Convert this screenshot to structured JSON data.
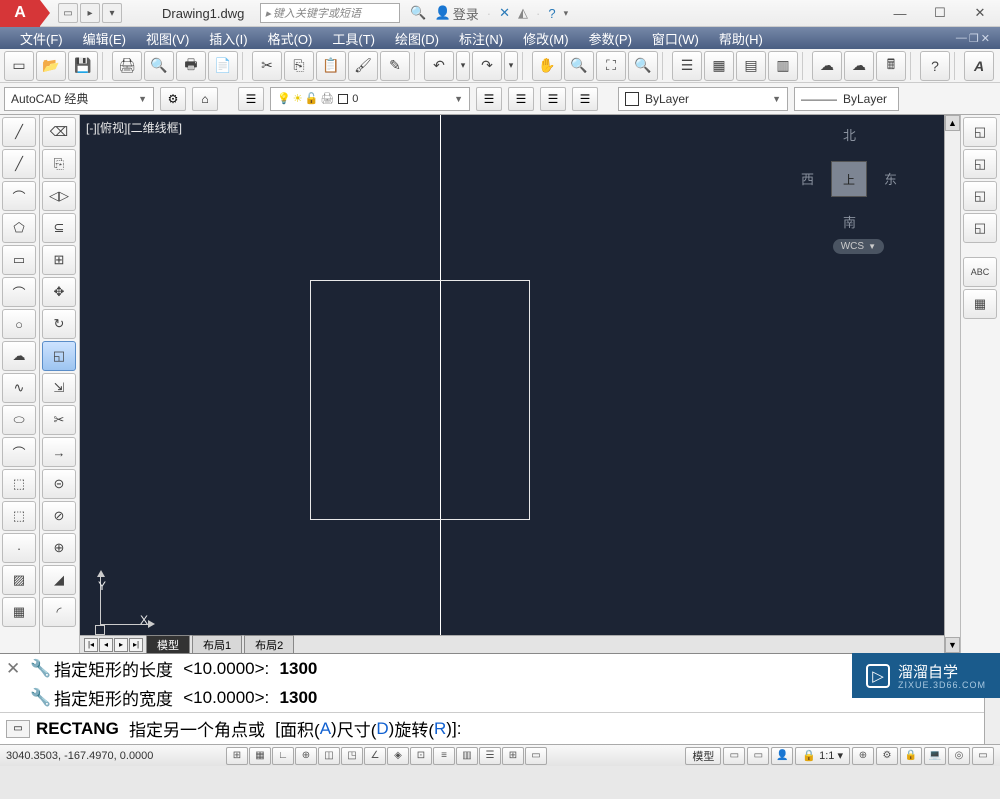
{
  "title": {
    "filename": "Drawing1.dwg",
    "search_placeholder": "键入关键字或短语",
    "login": "登录"
  },
  "menu": {
    "items": [
      "文件(F)",
      "编辑(E)",
      "视图(V)",
      "插入(I)",
      "格式(O)",
      "工具(T)",
      "绘图(D)",
      "标注(N)",
      "修改(M)",
      "参数(P)",
      "窗口(W)",
      "帮助(H)"
    ]
  },
  "workspace": {
    "label": "AutoCAD 经典"
  },
  "layer": {
    "combo": "0",
    "bylayer1": "ByLayer",
    "bylayer2": "ByLayer"
  },
  "canvas": {
    "label": "[-][俯视][二维线框]"
  },
  "viewcube": {
    "face": "上",
    "n": "北",
    "s": "南",
    "e": "东",
    "w": "西",
    "wcs": "WCS"
  },
  "tabs": {
    "model": "模型",
    "layout1": "布局1",
    "layout2": "布局2"
  },
  "cmd": {
    "hist1_label": "指定矩形的长度",
    "hist1_default": "<10.0000>:",
    "hist1_val": "1300",
    "hist2_label": "指定矩形的宽度",
    "hist2_default": "<10.0000>:",
    "hist2_val": "1300",
    "cmd_name": "RECTANG",
    "cmd_prompt": "指定另一个角点或",
    "opt_open": "[",
    "opt_a_label": "面积(",
    "opt_a": "A",
    "opt_a_close": ")",
    "opt_d_label": " 尺寸(",
    "opt_d": "D",
    "opt_d_close": ")",
    "opt_r_label": " 旋转(",
    "opt_r": "R",
    "opt_r_close": ")",
    "opt_close": "]:"
  },
  "status": {
    "coords": "3040.3503, -167.4970, 0.0000",
    "model": "模型",
    "scale": "1:1"
  },
  "watermark": {
    "title": "溜溜自学",
    "sub": "ZIXUE.3D66.COM"
  },
  "ucs": {
    "x": "X",
    "y": "Y"
  }
}
